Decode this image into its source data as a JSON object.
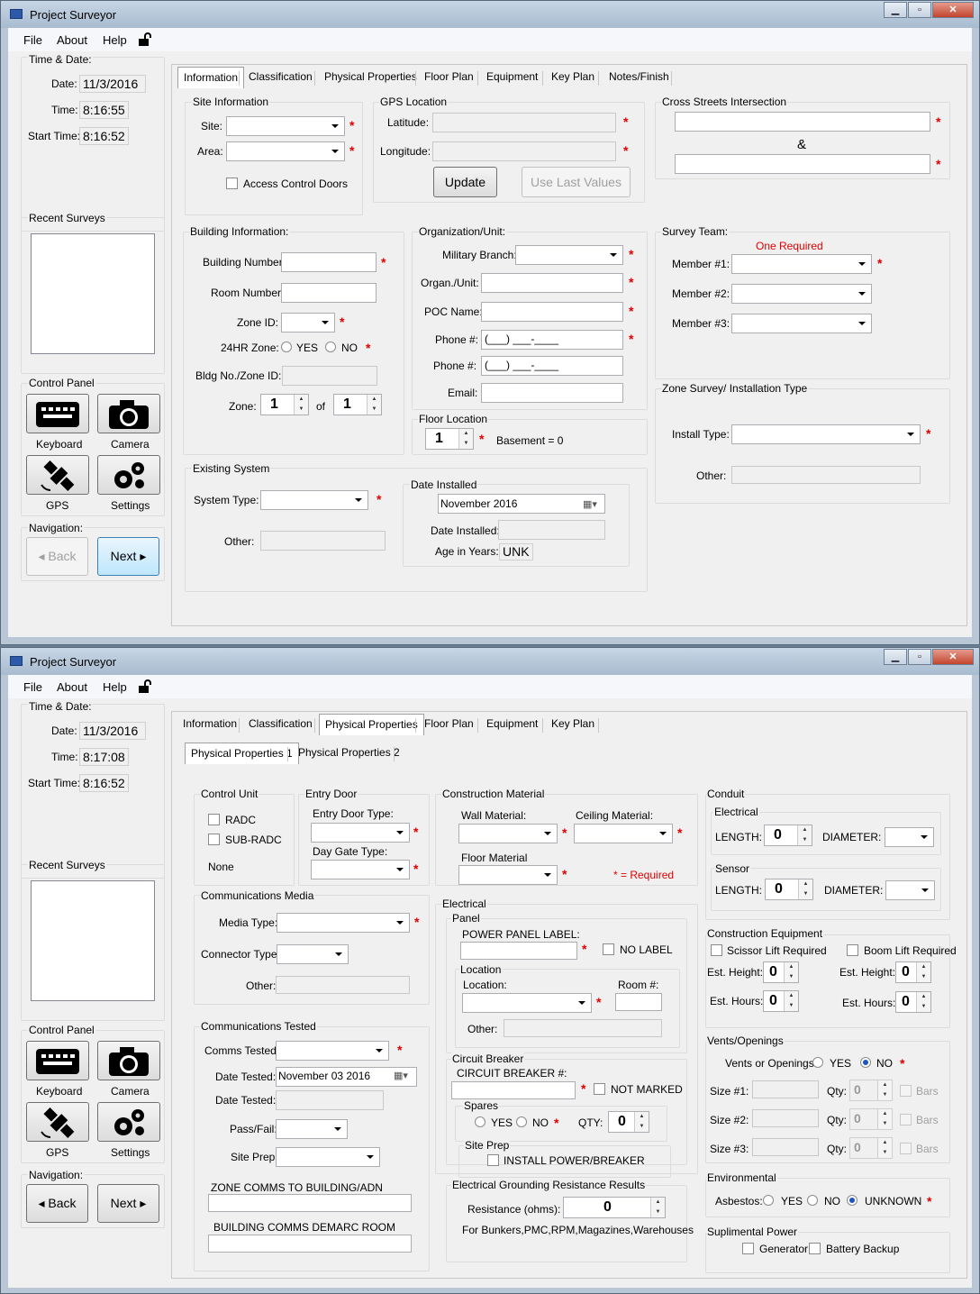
{
  "app": {
    "title": "Project Surveyor",
    "menu": [
      "File",
      "About",
      "Help"
    ]
  },
  "sidebar": {
    "time_date_label": "Time & Date:",
    "date_label": "Date:",
    "time_label": "Time:",
    "start_time_label": "Start Time:",
    "recent_label": "Recent Surveys",
    "control_panel_label": "Control Panel",
    "navigation_label": "Navigation:",
    "keyboard": "Keyboard",
    "camera": "Camera",
    "gps": "GPS",
    "settings": "Settings",
    "back": "Back",
    "next": "Next"
  },
  "w1": {
    "date": "11/3/2016",
    "time": "8:16:55",
    "start_time": "8:16:52",
    "tabs": [
      "Information",
      "Classification",
      "Physical Properties",
      "Floor Plan",
      "Equipment",
      "Key Plan",
      "Notes/Finish"
    ],
    "site_info": {
      "title": "Site Information",
      "site": "Site:",
      "area": "Area:",
      "access": "Access Control Doors"
    },
    "gps": {
      "title": "GPS Location",
      "latitude": "Latitude:",
      "longitude": "Longitude:",
      "update": "Update",
      "use_last": "Use Last Values"
    },
    "cross": {
      "title": "Cross Streets Intersection",
      "amp": "&"
    },
    "building": {
      "title": "Building Information:",
      "number": "Building Number:",
      "room": "Room Number:",
      "zone_id": "Zone ID:",
      "hr24": "24HR Zone:",
      "yes": "YES",
      "no": "NO",
      "bldg_zone": "Bldg No./Zone ID:",
      "zone": "Zone:",
      "zone_val": "1",
      "of": "of",
      "of_val": "1"
    },
    "org": {
      "title": "Organization/Unit:",
      "branch": "Military Branch:",
      "unit": "Organ./Unit:",
      "poc": "POC Name:",
      "phone1": "Phone #:",
      "phone2": "Phone #:",
      "phone_mask": "(___) ___-____",
      "email": "Email:"
    },
    "floor": {
      "title": "Floor Location",
      "val": "1",
      "basement": "Basement = 0"
    },
    "team": {
      "title": "Survey Team:",
      "one_required": "One Required",
      "m1": "Member #1:",
      "m2": "Member #2:",
      "m3": "Member #3:"
    },
    "zone_survey": {
      "title": "Zone Survey/ Installation Type",
      "install": "Install Type:",
      "other": "Other:"
    },
    "existing": {
      "title": "Existing System",
      "system_type": "System Type:",
      "other": "Other:"
    },
    "date_installed": {
      "title": "Date Installed",
      "picker": "November 2016",
      "label": "Date Installed:",
      "age_label": "Age in Years:",
      "age": "UNK"
    }
  },
  "w2": {
    "date": "11/3/2016",
    "time": "8:17:08",
    "start_time": "8:16:52",
    "tabs": [
      "Information",
      "Classification",
      "Physical Properties",
      "Floor Plan",
      "Equipment",
      "Key Plan"
    ],
    "subtabs": [
      "Physical Properties 1",
      "Physical Properties 2"
    ],
    "control_unit": {
      "title": "Control Unit",
      "radc": "RADC",
      "subradc": "SUB-RADC",
      "none": "None"
    },
    "entry": {
      "title": "Entry Door",
      "type": "Entry Door Type:",
      "gate": "Day Gate Type:"
    },
    "construction": {
      "title": "Construction Material",
      "wall": "Wall Material:",
      "ceiling": "Ceiling Material:",
      "floor": "Floor Material",
      "required": "* = Required"
    },
    "conduit": {
      "title": "Conduit",
      "electrical": "Electrical",
      "sensor": "Sensor",
      "length": "LENGTH:",
      "diameter": "DIAMETER:",
      "len_e": "0",
      "len_s": "0"
    },
    "media": {
      "title": "Communications Media",
      "type": "Media Type:",
      "connector": "Connector Type:",
      "other": "Other:"
    },
    "electrical": {
      "title": "Electrical",
      "panel": "Panel",
      "panel_label": "POWER PANEL LABEL:",
      "no_label": "NO LABEL",
      "location_grp": "Location",
      "location": "Location:",
      "room": "Room #:",
      "other": "Other:"
    },
    "equip": {
      "title": "Construction Equipment",
      "scissor": "Scissor Lift Required",
      "boom": "Boom Lift Required",
      "height": "Est. Height:",
      "hours": "Est. Hours:",
      "v": "0"
    },
    "tested": {
      "title": "Communications Tested",
      "comms": "Comms Tested:",
      "date": "Date Tested:",
      "date_val": "November 03 2016",
      "date2": "Date Tested:",
      "pass": "Pass/Fail:",
      "prep": "Site Prep:",
      "zone_comms": "ZONE COMMS TO BUILDING/ADN",
      "demarc": "BUILDING COMMS DEMARC ROOM"
    },
    "breaker": {
      "title": "Circuit Breaker",
      "number": "CIRCUIT BREAKER #:",
      "not_marked": "NOT MARKED",
      "spares": "Spares",
      "yes": "YES",
      "no": "NO",
      "qty": "QTY:",
      "qty_val": "0",
      "site_prep": "Site Prep",
      "install": "INSTALL POWER/BREAKER"
    },
    "vents": {
      "title": "Vents/Openings",
      "question": "Vents or Openings",
      "yes": "YES",
      "no": "NO",
      "size1": "Size #1:",
      "size2": "Size #2:",
      "size3": "Size #3:",
      "qty": "Qty:",
      "qty_val": "0",
      "bars": "Bars"
    },
    "ground": {
      "title": "Electrical Grounding Resistance Results",
      "resistance": "Resistance (ohms):",
      "val": "0",
      "note": "For Bunkers,PMC,RPM,Magazines,Warehouses"
    },
    "env": {
      "title": "Environmental",
      "asbestos": "Asbestos:",
      "yes": "YES",
      "no": "NO",
      "unknown": "UNKNOWN"
    },
    "power": {
      "title": "Suplimental Power",
      "generator": "Generator",
      "battery": "Battery Backup"
    }
  }
}
